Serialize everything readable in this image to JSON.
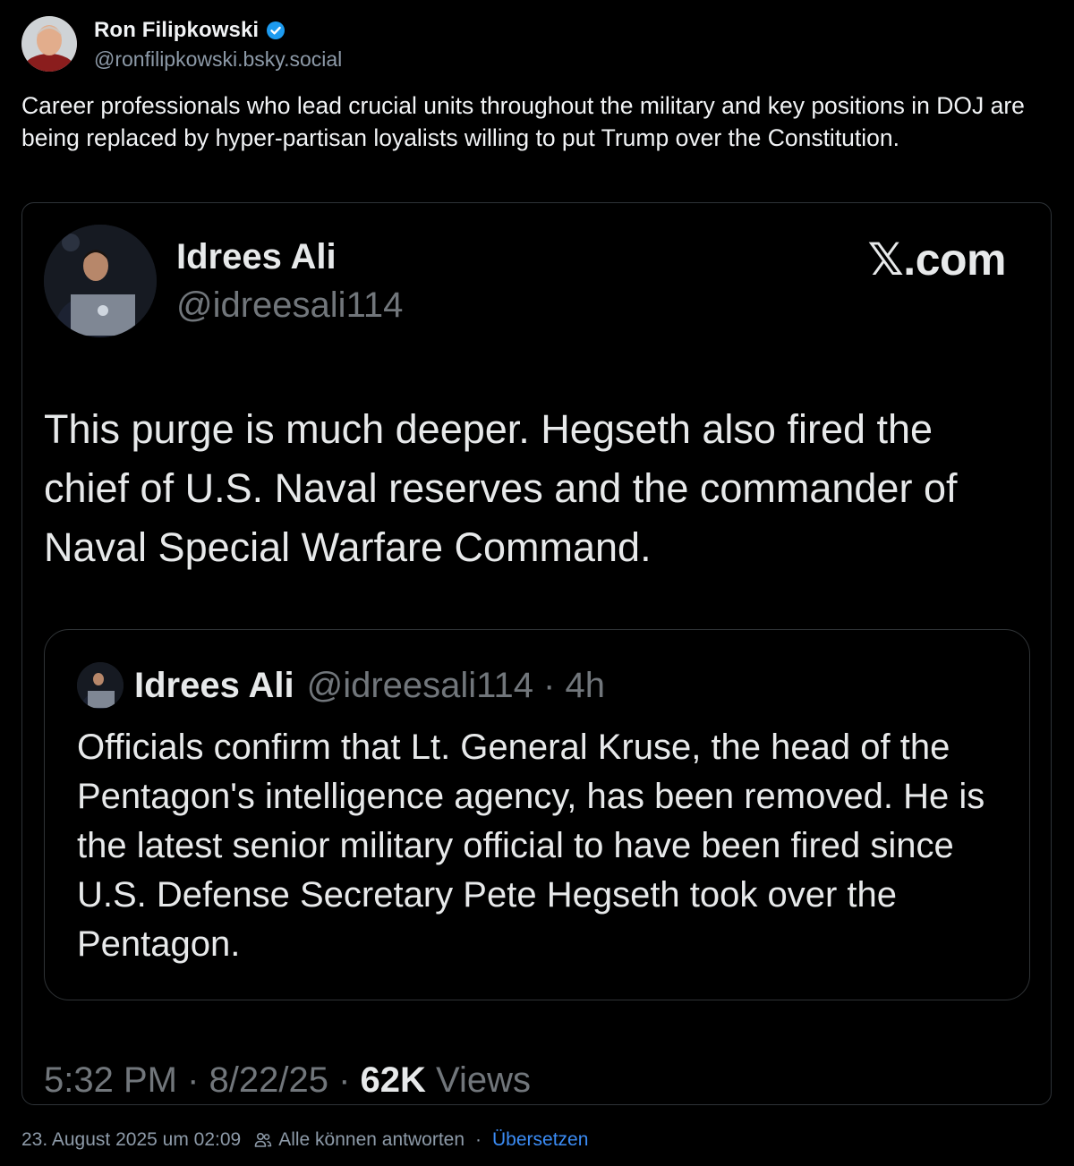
{
  "author": {
    "display_name": "Ron Filipkowski",
    "handle": "@ronfilipkowski.bsky.social",
    "avatar_icon": "avatar",
    "verified_icon": "verified-badge-icon",
    "verified_color": "#1d9bf0"
  },
  "post": {
    "text": "Career professionals who lead crucial units throughout the military and key positions in DOJ are being replaced by hyper-partisan loyalists willing to put Trump over the Constitution."
  },
  "embed": {
    "author_name": "Idrees Ali",
    "author_handle": "@idreesali114",
    "brand": "𝕏.com",
    "text": "This purge is much deeper. Hegseth also fired the chief of U.S. Naval reserves and the commander of Naval Special Warfare Command.",
    "quote": {
      "author_name": "Idrees Ali",
      "meta": "@idreesali114 · 4h",
      "text": "Officials confirm that Lt. General Kruse, the head of the Pentagon's intelligence agency, has been removed. He is the latest senior military official to have been fired since U.S. Defense Secretary Pete Hegseth took over the Pentagon."
    },
    "footer": {
      "time_date": "5:32 PM · 8/22/25 · ",
      "views_count": "62K",
      "views_label": " Views"
    }
  },
  "meta": {
    "timestamp": "23. August 2025 um 02:09",
    "reply_setting": "Alle können antworten",
    "separator": "·",
    "translate_label": "Übersetzen",
    "translate_color": "#3b8cf5"
  }
}
